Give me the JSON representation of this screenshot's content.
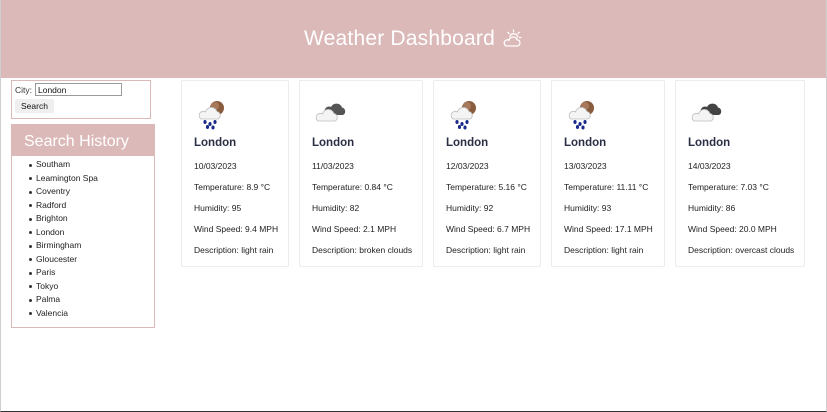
{
  "header": {
    "title": "Weather Dashboard",
    "icon": "partly-cloudy-day-icon"
  },
  "search": {
    "label": "City:",
    "value": "London",
    "button_label": "Search"
  },
  "history": {
    "title": "Search History",
    "items": [
      "Southam",
      "Leamington Spa",
      "Coventry",
      "Radford",
      "Brighton",
      "London",
      "Birmingham",
      "Gloucester",
      "Paris",
      "Tokyo",
      "Palma",
      "Valencia"
    ]
  },
  "forecast": [
    {
      "city": "London",
      "date": "10/03/2023",
      "temperature": "Temperature: 8.9 °C",
      "humidity": "Humidity: 95",
      "wind": "Wind Speed: 9.4 MPH",
      "description": "Description: light rain",
      "icon": "rain-icon"
    },
    {
      "city": "London",
      "date": "11/03/2023",
      "temperature": "Temperature: 0.84 °C",
      "humidity": "Humidity: 82",
      "wind": "Wind Speed: 2.1 MPH",
      "description": "Description: broken clouds",
      "icon": "broken-clouds-icon"
    },
    {
      "city": "London",
      "date": "12/03/2023",
      "temperature": "Temperature: 5.16 °C",
      "humidity": "Humidity: 92",
      "wind": "Wind Speed: 6.7 MPH",
      "description": "Description: light rain",
      "icon": "rain-icon"
    },
    {
      "city": "London",
      "date": "13/03/2023",
      "temperature": "Temperature: 11.11 °C",
      "humidity": "Humidity: 93",
      "wind": "Wind Speed: 17.1 MPH",
      "description": "Description: light rain",
      "icon": "rain-icon"
    },
    {
      "city": "London",
      "date": "14/03/2023",
      "temperature": "Temperature: 7.03 °C",
      "humidity": "Humidity: 86",
      "wind": "Wind Speed: 20.0 MPH",
      "description": "Description: overcast clouds",
      "icon": "overcast-clouds-icon"
    }
  ]
}
